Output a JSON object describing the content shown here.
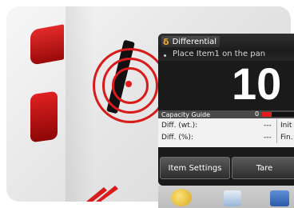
{
  "screen": {
    "mode": {
      "icon": "delta-icon",
      "glyph": "δ",
      "label": "Differential"
    },
    "prompt": "Place Item1 on the pan",
    "main_value": "10",
    "capacity_guide": {
      "label": "Capacity Guide",
      "zero_label": "0",
      "fill_fraction": 0.3
    },
    "diff_weight": {
      "label": "Diff. (wt.):",
      "value": "---",
      "right_label": "Init"
    },
    "diff_percent": {
      "label": "Diff. (%):",
      "value": "---",
      "right_label": "Fin."
    },
    "buttons": [
      {
        "label": "Item Settings"
      },
      {
        "label": "Tare"
      }
    ]
  },
  "colors": {
    "accent_red": "#d81b1b",
    "mode_icon": "#f5a623"
  }
}
